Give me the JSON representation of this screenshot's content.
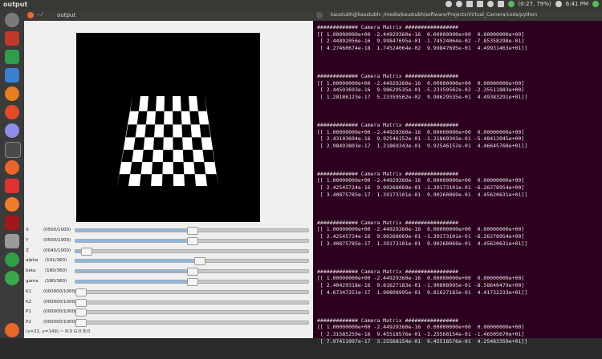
{
  "topbar": {
    "title": "output",
    "battery": "(0:27, 79%)",
    "clock": "6:41 PM"
  },
  "launcher": {
    "icons": [
      "ubuntu-dash-icon",
      "app-red-icon",
      "app-green-icon",
      "app-blue-icon",
      "firefox-icon",
      "app-orange-icon",
      "settings-icon",
      "terminal-icon",
      "firefox-alt-icon",
      "app-red-s-icon",
      "app-orange-s-icon",
      "app-red-dark-icon",
      "files-icon",
      "app-green-icon-2",
      "app-green-icon-3",
      "system-bottom-icon"
    ]
  },
  "output_window": {
    "title": "output",
    "status": "(x=22, y=149) ~ R:0 G:0 B:0",
    "sliders": [
      {
        "label": "X",
        "value": "(0500/1000)",
        "level": 0.5
      },
      {
        "label": "Y",
        "value": "(0500/1000)",
        "level": 0.5
      },
      {
        "label": "Z",
        "value": "(0045/1000)",
        "level": 0.045
      },
      {
        "label": "alpha",
        "value": "(191/360)",
        "level": 0.53
      },
      {
        "label": "beta",
        "value": "(180/360)",
        "level": 0.5
      },
      {
        "label": "gama",
        "value": "(180/360)",
        "level": 0.5
      },
      {
        "label": "K1",
        "value": "(000000/100000)",
        "level": 0.0
      },
      {
        "label": "K2",
        "value": "(000000/100000)",
        "level": 0.0
      },
      {
        "label": "P1",
        "value": "(000000/100000)",
        "level": 0.0
      },
      {
        "label": "P2",
        "value": "(000000/100000)",
        "level": 0.0
      }
    ]
  },
  "terminal": {
    "title": "kaustubh@kaustubh: /media/kaustubh/software/Projects/Virtual_Camera/code/python",
    "blocks": [
      {
        "header": "############# Camera Matrix #################",
        "rows": [
          "[[ 1.00000000e+00 -2.44929360e-16  0.00000000e+00  0.00000000e+00]",
          " [ 2.44892056e-16  9.99847695e-01 -1.74524064e-02 -7.85358298e-01]",
          " [ 4.27460674e-18  1.74524064e-02  9.99847695e-01  4.49931463e+01]]"
        ]
      },
      {
        "header": "############# Camera Matrix #################",
        "rows": [
          "[[ 1.00000000e+00 -2.44929360e-16  0.00000000e+00  0.00000000e+00]",
          " [ 2.44593693e-16  9.98629535e-01 -5.23359562e-02 -2.35511883e+00]",
          " [ 1.28186123e-17  5.23359562e-02  9.98629535e-01  4.49383291e+01]]"
        ]
      },
      {
        "header": "############# Camera Matrix #################",
        "rows": [
          "[[ 1.00000000e+00 -2.44929360e-16  0.00000000e+00  0.00000000e+00]",
          " [ 2.43103694e-16  9.92546152e-01 -1.21869343e-01 -5.48412045e+00]",
          " [ 2.98493803e-17  1.21869343e-01  9.92546152e-01  4.46645768e+01]]"
        ]
      },
      {
        "header": "############# Camera Matrix #################",
        "rows": [
          "[[ 1.00000000e+00 -2.44929360e-16  0.00000000e+00  0.00000000e+00]",
          " [ 2.42545724e-16  9.90268069e-01 -1.39173101e-01 -6.26278954e+00]",
          " [ 3.40875785e-17  1.39173101e-01  9.90268069e-01  4.45620631e+01]]"
        ]
      },
      {
        "header": "############# Camera Matrix #################",
        "rows": [
          "[[ 1.00000000e+00 -2.44929360e-16  0.00000000e+00  0.00000000e+00]",
          " [ 2.42545724e-16  9.90268069e-01 -1.39173101e-01 -6.26278954e+00]",
          " [ 3.40875785e-17  1.39173101e-01  9.90268069e-01  4.45620631e+01]]"
        ]
      },
      {
        "header": "############# Camera Matrix #################",
        "rows": [
          "[[ 1.00000000e+00 -2.44929360e-16  0.00000000e+00  0.00000000e+00]",
          " [ 2.40429318e-16  9.81627183e-01 -1.90808995e-01 -8.58640479e+00]",
          " [ 4.67347251e-17  1.90808995e-01  9.81627183e-01  4.41732233e+01]]"
        ]
      },
      {
        "header": "############# Camera Matrix #################",
        "rows": [
          "[[ 1.00000000e+00 -2.44929360e-16  0.00000000e+00  0.00000000e+00]",
          " [ 2.31585259e-16  9.45518576e-01 -3.25568154e-01 -1.46505670e+01]",
          " [ 7.97411997e-17  3.25568154e-01  9.45518576e-01  4.25483359e+01]]"
        ]
      }
    ]
  }
}
